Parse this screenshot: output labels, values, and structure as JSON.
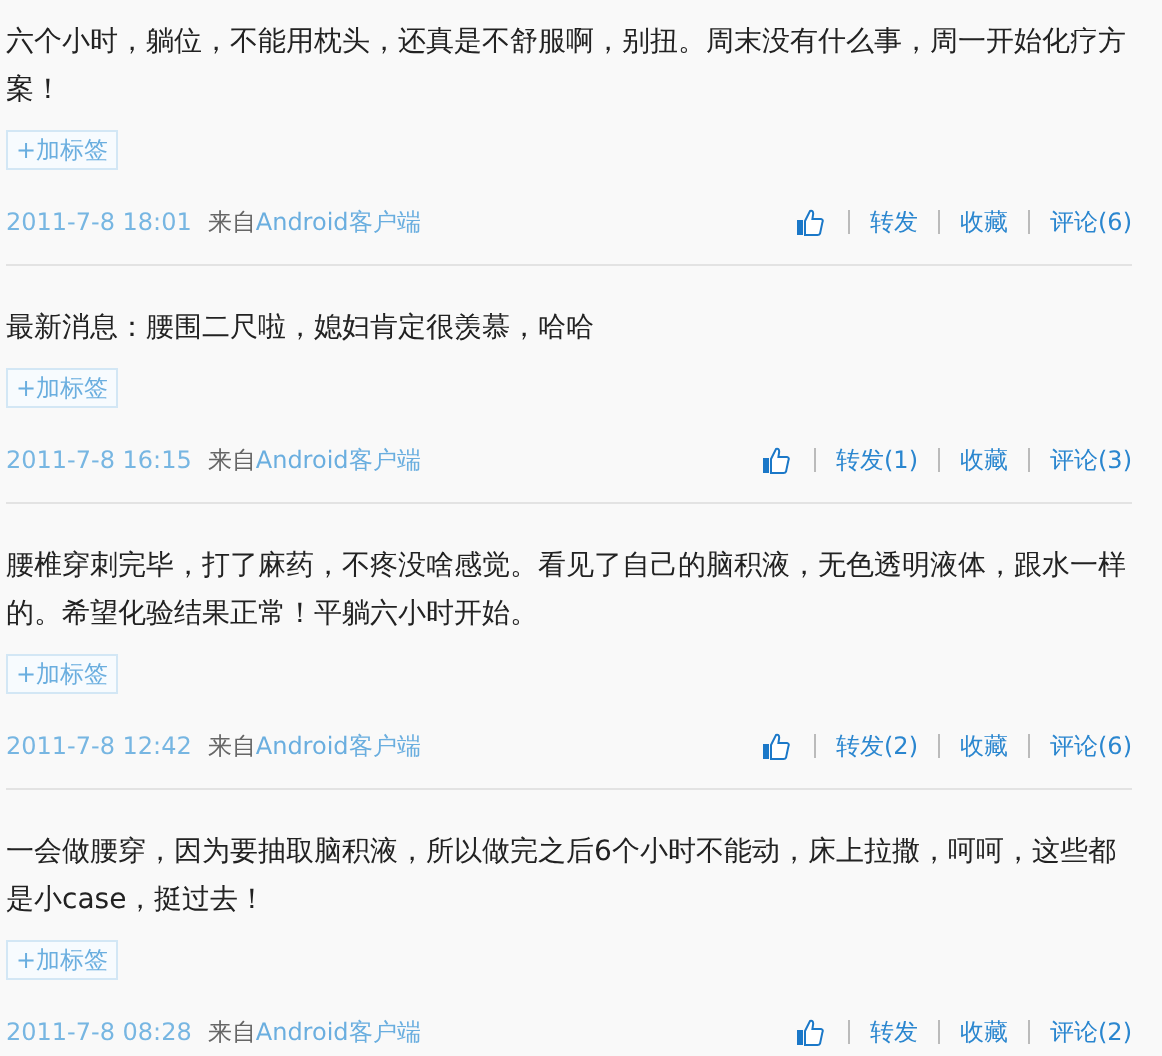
{
  "posts": [
    {
      "text": "六个小时，躺位，不能用枕头，还真是不舒服啊，别扭。周末没有什么事，周一开始化疗方案！",
      "tag_button": "+加标签",
      "time": "2011-7-8 18:01",
      "source_prefix": "来自",
      "source_link": "Android客户端",
      "actions": [
        "转发",
        "收藏",
        "评论(6)"
      ]
    },
    {
      "text": "最新消息：腰围二尺啦，媳妇肯定很羡慕，哈哈",
      "tag_button": "+加标签",
      "time": "2011-7-8 16:15",
      "source_prefix": "来自",
      "source_link": "Android客户端",
      "actions": [
        "转发(1)",
        "收藏",
        "评论(3)"
      ]
    },
    {
      "text": "腰椎穿刺完毕，打了麻药，不疼没啥感觉。看见了自己的脑积液，无色透明液体，跟水一样的。希望化验结果正常！平躺六小时开始。",
      "tag_button": "+加标签",
      "time": "2011-7-8 12:42",
      "source_prefix": "来自",
      "source_link": "Android客户端",
      "actions": [
        "转发(2)",
        "收藏",
        "评论(6)"
      ]
    },
    {
      "text": "一会做腰穿，因为要抽取脑积液，所以做完之后6个小时不能动，床上拉撒，呵呵，这些都是小case，挺过去！",
      "tag_button": "+加标签",
      "time": "2011-7-8 08:28",
      "source_prefix": "来自",
      "source_link": "Android客户端",
      "actions": [
        "转发",
        "收藏",
        "评论(2)"
      ]
    }
  ]
}
